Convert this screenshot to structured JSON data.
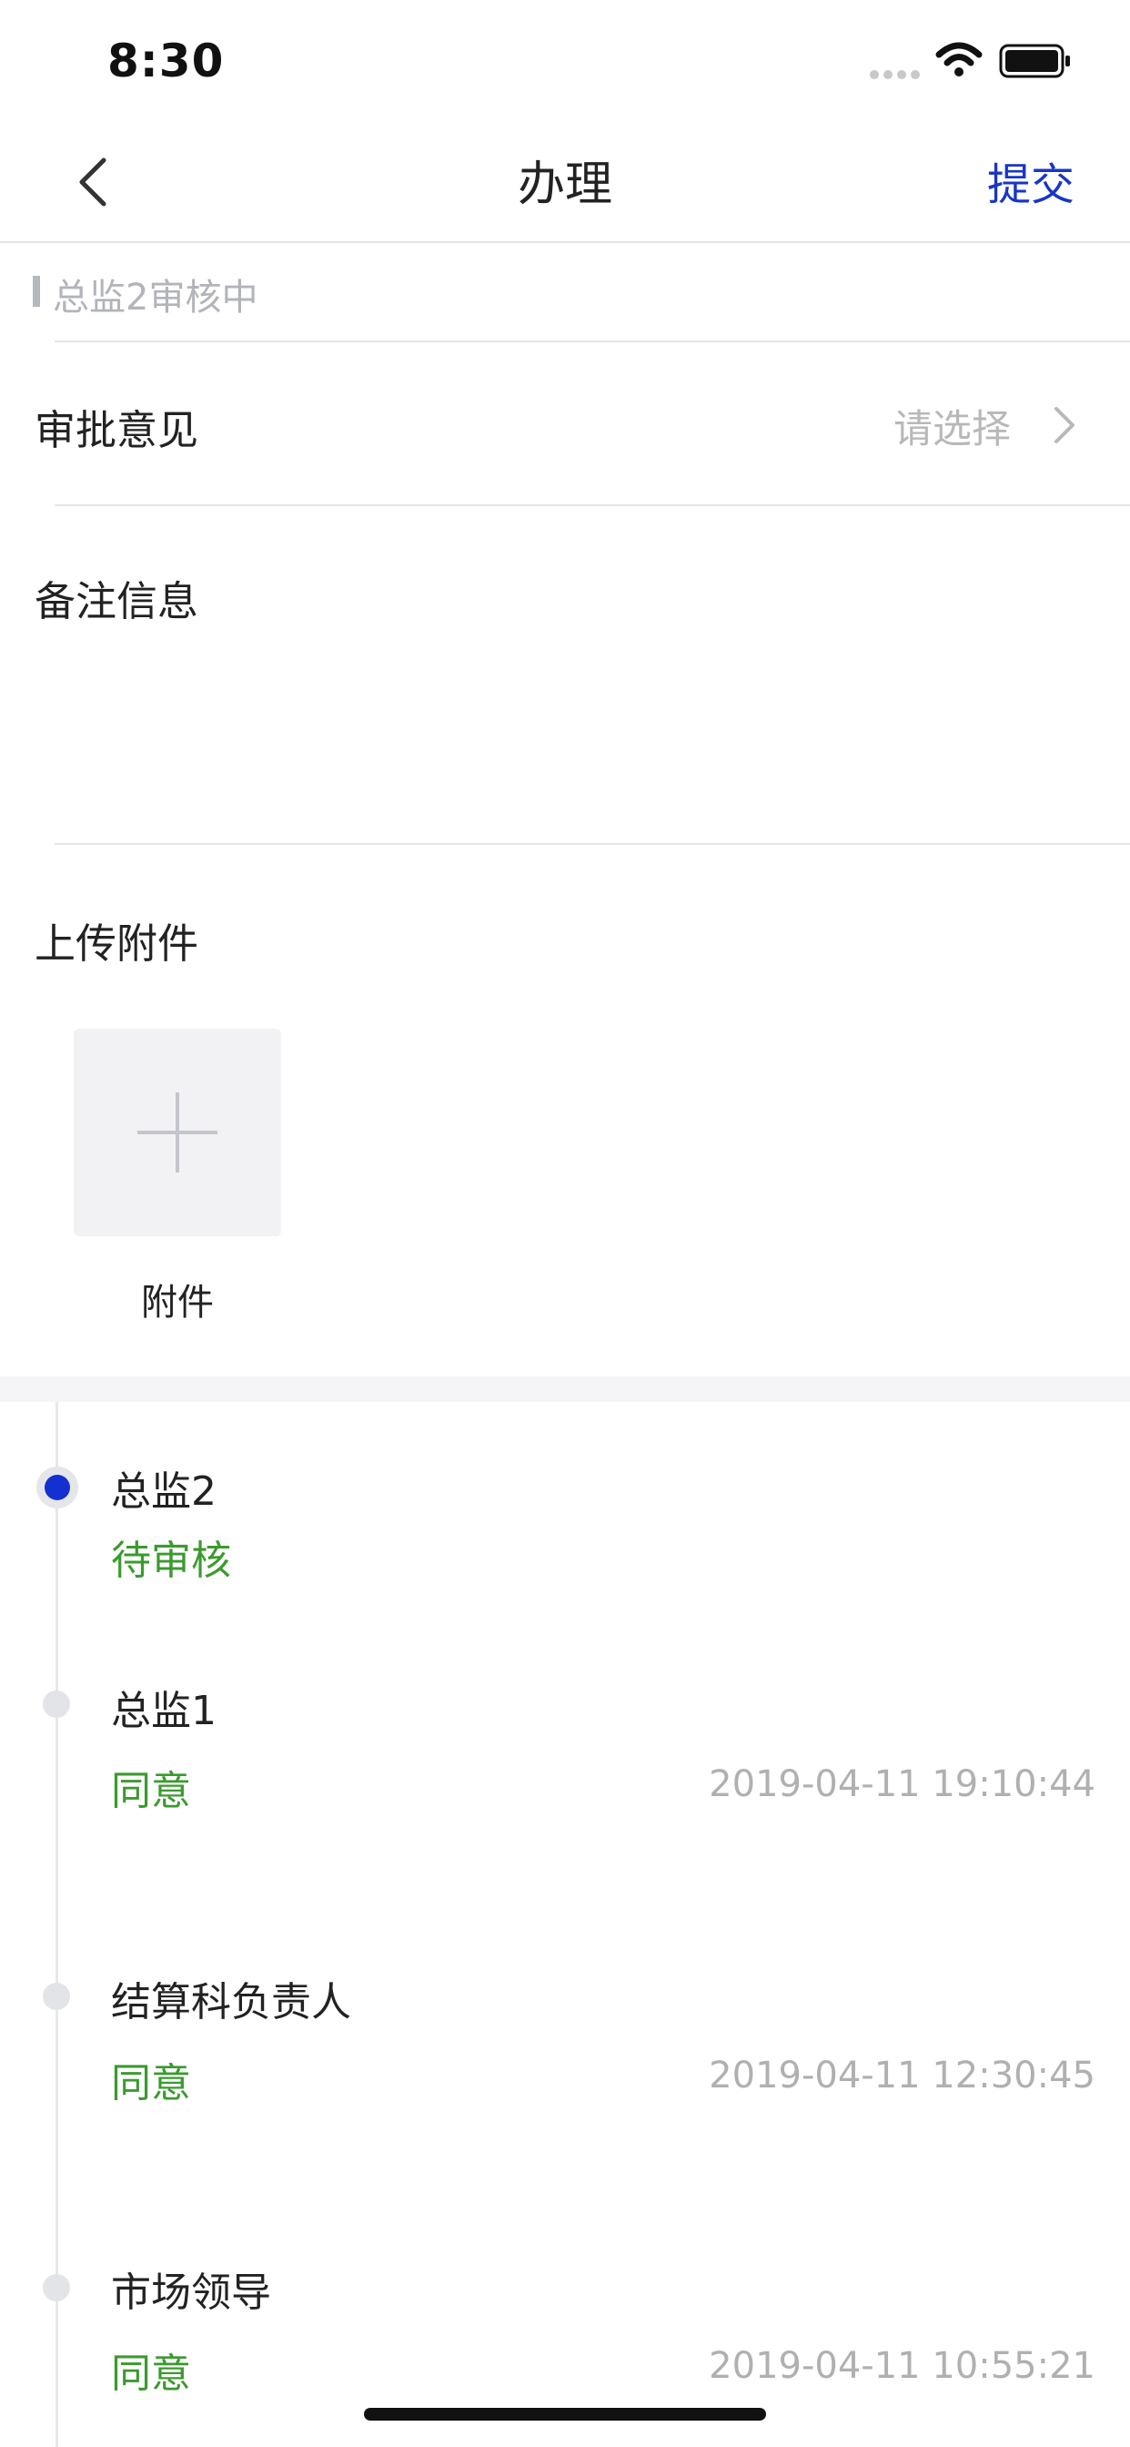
{
  "status_bar": {
    "time": "8:30"
  },
  "nav": {
    "title": "办理",
    "submit_label": "提交"
  },
  "stage": {
    "text": "总监2审核中"
  },
  "form": {
    "opinion_label": "审批意见",
    "opinion_placeholder": "请选择",
    "remark_label": "备注信息",
    "upload_label": "上传附件",
    "attachment_label": "附件"
  },
  "timeline": [
    {
      "name": "总监2",
      "status": "待审核",
      "time": "",
      "active": true
    },
    {
      "name": "总监1",
      "status": "同意",
      "time": "2019-04-11 19:10:44",
      "active": false
    },
    {
      "name": "结算科负责人",
      "status": "同意",
      "time": "2019-04-11 12:30:45",
      "active": false
    },
    {
      "name": "市场领导",
      "status": "同意",
      "time": "2019-04-11 10:55:21",
      "active": false
    }
  ],
  "colors": {
    "accent": "#1a35c8",
    "active_dot": "#1430d0",
    "status_green": "#3b9a2f",
    "muted_text": "#b0b0b0"
  },
  "icons": {
    "back": "chevron-left-icon",
    "select": "chevron-right-icon",
    "add": "plus-icon",
    "wifi": "wifi-icon",
    "battery": "battery-icon"
  }
}
